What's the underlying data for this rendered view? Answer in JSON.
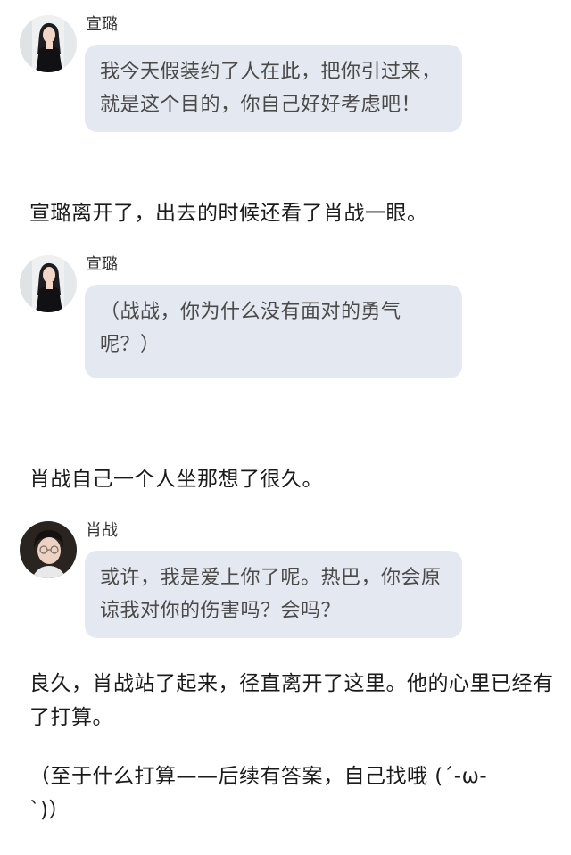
{
  "messages": [
    {
      "speaker": "宣璐",
      "avatar": "woman-portrait-icon",
      "text": "我今天假装约了人在此，把你引过来，就是这个目的，你自己好好考虑吧！"
    },
    {
      "speaker": "宣璐",
      "avatar": "woman-portrait-icon",
      "text": "（战战，你为什么没有面对的勇气呢？）"
    },
    {
      "speaker": "肖战",
      "avatar": "man-portrait-icon",
      "text": "或许，我是爱上你了呢。热巴，你会原谅我对你的伤害吗？会吗？"
    }
  ],
  "narration": {
    "line1": "宣璐离开了，出去的时候还看了肖战一眼。",
    "divider": "-----------------------------------------------------------------",
    "line2": "肖战自己一个人坐那想了很久。",
    "line3": "良久，肖战站了起来，径直离开了这里。他的心里已经有了打算。",
    "line4": "（至于什么打算——后续有答案，自己找哦 (´-ω-`)）"
  },
  "colors": {
    "bubble_bg": "#e4e8f0",
    "bubble_text": "#4a4a4a",
    "narration_text": "#1a1a1a"
  }
}
